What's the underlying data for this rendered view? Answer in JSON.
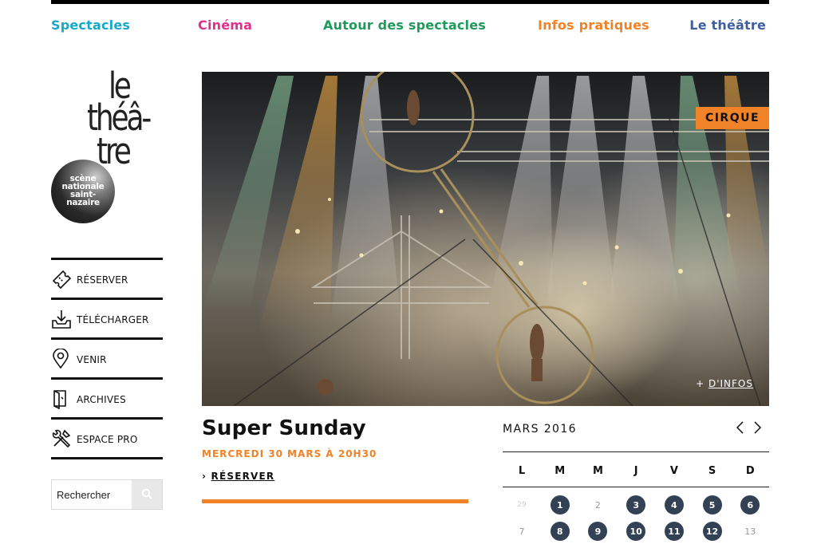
{
  "nav": {
    "items": [
      {
        "label": "Spectacles",
        "color": "#16a9c9"
      },
      {
        "label": "Cinéma",
        "color": "#e0318c"
      },
      {
        "label": "Autour des spectacles",
        "color": "#1f9a5b"
      },
      {
        "label": "Infos pratiques",
        "color": "#f08228"
      },
      {
        "label": "Le théâtre",
        "color": "#3f5f9e"
      }
    ]
  },
  "logo": {
    "line1": "le",
    "line2": "théâ-",
    "line3": "tre",
    "disc_text": [
      "scène",
      "nationale",
      "saint-",
      "nazaire"
    ]
  },
  "sidebar": {
    "items": [
      {
        "label": "RÉSERVER",
        "icon": "ticket-icon"
      },
      {
        "label": "TÉLÉCHARGER",
        "icon": "download-icon"
      },
      {
        "label": "VENIR",
        "icon": "map-pin-icon"
      },
      {
        "label": "ARCHIVES",
        "icon": "archive-icon"
      },
      {
        "label": "ESPACE PRO",
        "icon": "tools-icon"
      }
    ]
  },
  "search": {
    "placeholder": "Rechercher",
    "icon": "search-icon"
  },
  "hero": {
    "badge": "CIRQUE",
    "more_prefix": "+ ",
    "more_label": "D'INFOS",
    "accent": "#f08228"
  },
  "event": {
    "title": "Super Sunday",
    "date": "MERCREDI 30 MARS À 20H30",
    "reserve_prefix": "› ",
    "reserve_label": "RÉSERVER"
  },
  "calendar": {
    "month": "MARS 2016",
    "weekdays": [
      "L",
      "M",
      "M",
      "J",
      "V",
      "S",
      "D"
    ],
    "rows": [
      [
        {
          "d": "29",
          "s": "other"
        },
        {
          "d": "1",
          "s": "event"
        },
        {
          "d": "2",
          "s": "plain"
        },
        {
          "d": "3",
          "s": "event"
        },
        {
          "d": "4",
          "s": "event"
        },
        {
          "d": "5",
          "s": "event"
        },
        {
          "d": "6",
          "s": "event"
        }
      ],
      [
        {
          "d": "7",
          "s": "plain"
        },
        {
          "d": "8",
          "s": "event"
        },
        {
          "d": "9",
          "s": "event"
        },
        {
          "d": "10",
          "s": "event"
        },
        {
          "d": "11",
          "s": "event"
        },
        {
          "d": "12",
          "s": "event"
        },
        {
          "d": "13",
          "s": "plain"
        }
      ]
    ],
    "event_color": "#334155"
  }
}
